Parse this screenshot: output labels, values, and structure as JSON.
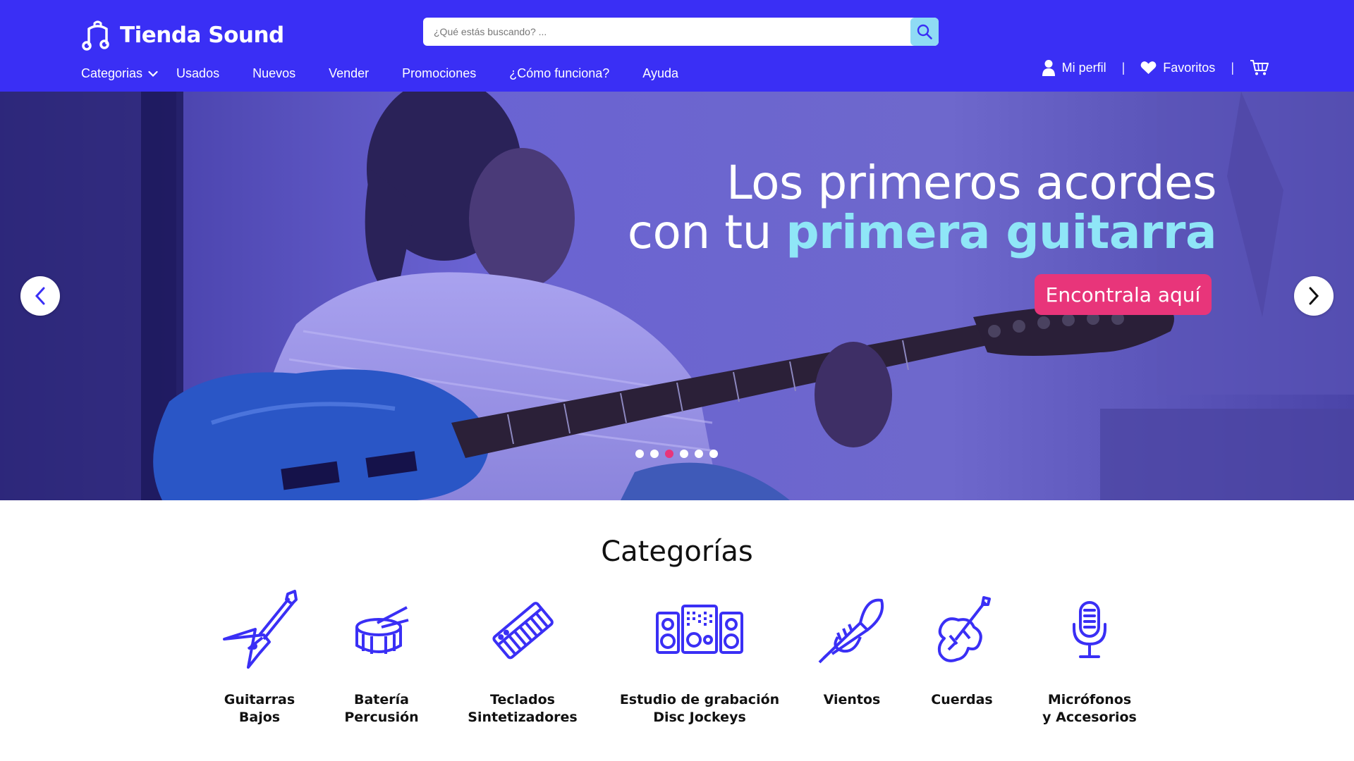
{
  "brand": {
    "name": "Tienda Sound",
    "primary_color": "#3a2ff5",
    "accent_color": "#e8357a",
    "highlight_color": "#8fe6f7"
  },
  "search": {
    "placeholder": "¿Qué estás buscando? ...",
    "icon": "search-icon"
  },
  "nav": {
    "categories": "Categorias",
    "used": "Usados",
    "new": "Nuevos",
    "sell": "Vender",
    "promotions": "Promociones",
    "how": "¿Cómo funciona?",
    "help": "Ayuda"
  },
  "account": {
    "profile": "Mi perfil",
    "favorites": "Favoritos",
    "separator": "|",
    "cart_icon": "cart-icon"
  },
  "hero": {
    "line1": "Los primeros acordes",
    "line2_plain": "con tu",
    "line2_accent": "primera guitarra",
    "cta": "Encontrala aquí",
    "slides": 6,
    "active_slide": 3
  },
  "categories": {
    "title": "Categorías",
    "items": [
      {
        "line1": "Guitarras",
        "line2": "Bajos",
        "icon": "electric-guitar-icon"
      },
      {
        "line1": "Batería",
        "line2": "Percusión",
        "icon": "drum-icon"
      },
      {
        "line1": "Teclados",
        "line2": "Sintetizadores",
        "icon": "keyboard-icon"
      },
      {
        "line1": "Estudio de grabación",
        "line2": "Disc Jockeys",
        "icon": "speakers-icon"
      },
      {
        "line1": "Vientos",
        "line2": "",
        "icon": "trumpet-icon"
      },
      {
        "line1": "Cuerdas",
        "line2": "",
        "icon": "violin-icon"
      },
      {
        "line1": "Micrófonos",
        "line2": "y Accesorios",
        "icon": "microphone-icon"
      }
    ]
  }
}
